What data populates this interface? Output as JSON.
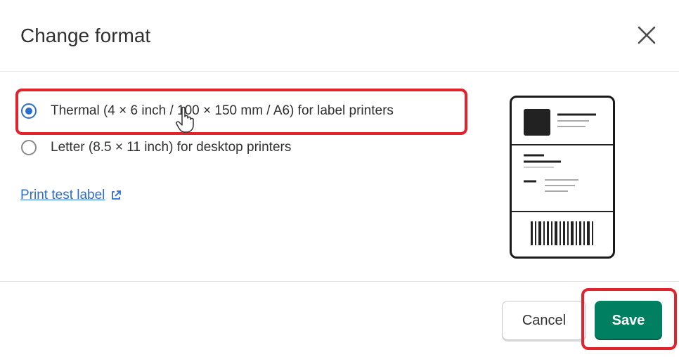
{
  "dialog": {
    "title": "Change format",
    "close_icon": "close-icon"
  },
  "options": [
    {
      "label": "Thermal (4 × 6 inch / 100 × 150 mm / A6) for label printers",
      "checked": true
    },
    {
      "label": "Letter (8.5 × 11 inch) for desktop printers",
      "checked": false
    }
  ],
  "test_link": {
    "label": "Print test label",
    "icon": "external-link-icon"
  },
  "footer": {
    "cancel_label": "Cancel",
    "save_label": "Save"
  },
  "colors": {
    "accent_blue": "#2c6ecb",
    "save_green": "#008060",
    "highlight_red": "#e3232b"
  }
}
